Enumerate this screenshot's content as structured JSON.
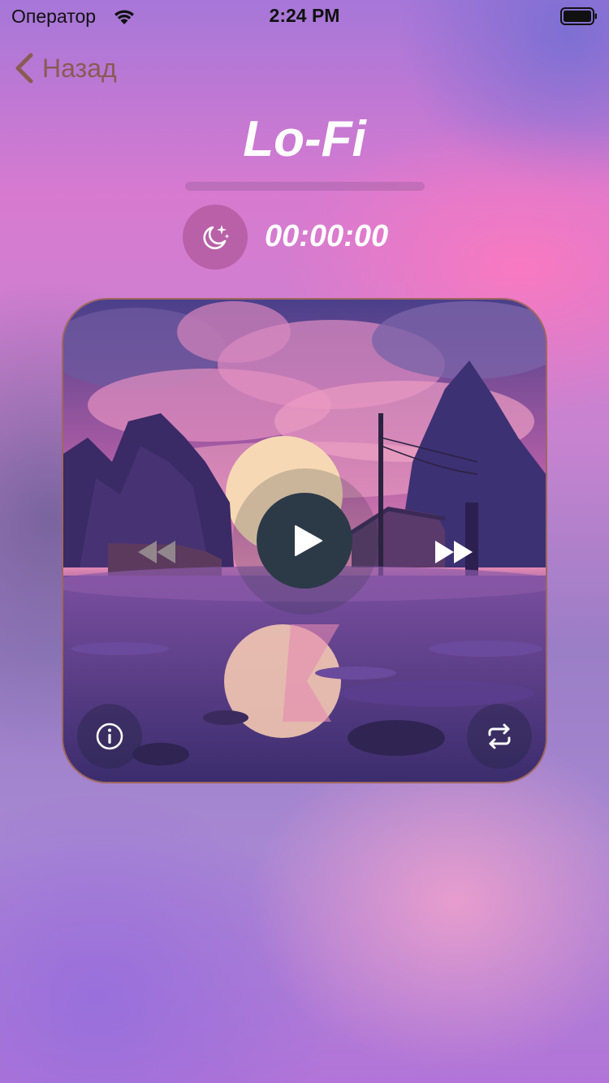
{
  "status_bar": {
    "carrier": "Оператор",
    "time": "2:24 PM"
  },
  "nav": {
    "back_label": "Назад"
  },
  "player": {
    "title": "Lo-Fi",
    "sleep_timer": "00:00:00"
  },
  "icons": {
    "back": "chevron-left-icon",
    "sleep": "moon-stars-icon",
    "play": "play-icon",
    "rewind": "rewind-icon",
    "forward": "fast-forward-icon",
    "info": "info-icon",
    "repeat": "repeat-icon"
  },
  "colors": {
    "back_tint": "#8a5a55",
    "play_button": "#2c3a48",
    "text": "#ffffff"
  }
}
